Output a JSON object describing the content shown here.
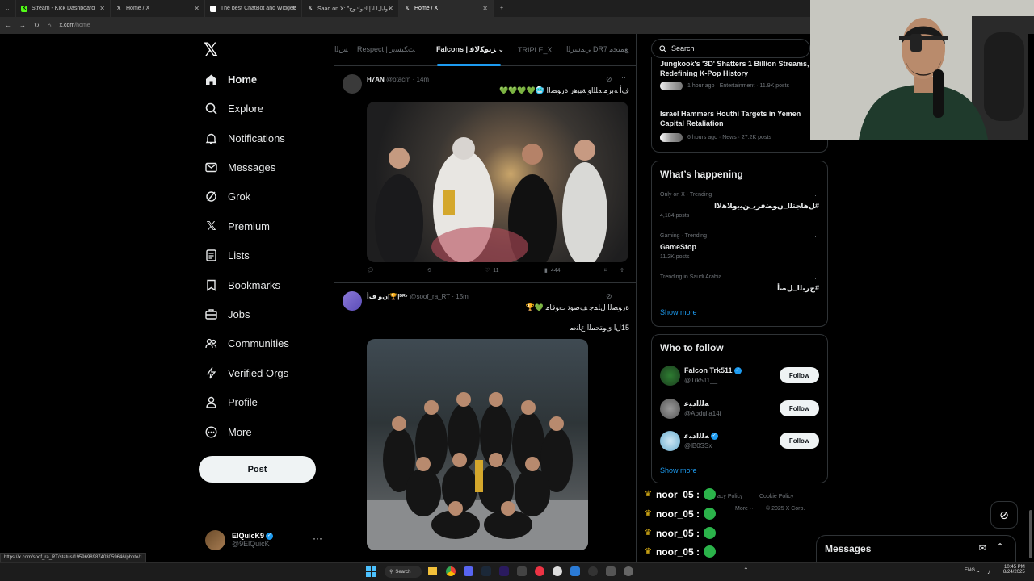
{
  "browser": {
    "tabs": [
      {
        "title": "Stream - Kick Dashboard",
        "icon": "kick-icon",
        "color": "#53fc18"
      },
      {
        "title": "Home / X",
        "icon": "x-icon",
        "color": "#ffffff"
      },
      {
        "title": "The best ChatBot and Widgets",
        "icon": "chatbot-icon",
        "color": "#ffffff"
      },
      {
        "title": "Saad on X: \"ﺫﻭﺍﺑﻝﺍ ﺍﺫﺇ ﻙﻭﻙﻭﺝ",
        "icon": "x-icon",
        "color": "#ffffff"
      },
      {
        "title": "Home / X",
        "icon": "x-icon",
        "color": "#ffffff",
        "active": true
      }
    ],
    "url_host": "x.com",
    "url_path": "/home",
    "status_url": "https://x.com/soof_ra_RT/status/1959698987403059646/photo/1"
  },
  "nav": {
    "items": [
      {
        "label": "Home",
        "icon": "home-icon"
      },
      {
        "label": "Explore",
        "icon": "search-icon"
      },
      {
        "label": "Notifications",
        "icon": "bell-icon"
      },
      {
        "label": "Messages",
        "icon": "mail-icon"
      },
      {
        "label": "Grok",
        "icon": "grok-icon"
      },
      {
        "label": "Premium",
        "icon": "x-icon"
      },
      {
        "label": "Lists",
        "icon": "list-icon"
      },
      {
        "label": "Bookmarks",
        "icon": "bookmark-icon"
      },
      {
        "label": "Jobs",
        "icon": "briefcase-icon"
      },
      {
        "label": "Communities",
        "icon": "people-icon"
      },
      {
        "label": "Verified Orgs",
        "icon": "lightning-icon"
      },
      {
        "label": "Profile",
        "icon": "person-icon"
      },
      {
        "label": "More",
        "icon": "more-circle-icon"
      }
    ],
    "post_label": "Post",
    "account_name": "ElQuicK9",
    "account_handle": "@9ElQuicK"
  },
  "timeline": {
    "tabs": [
      "ﺲﻟﺍ",
      "Respect | ﺖﻜﺒﺴﻳﺭ",
      "Falcons | ﺰﻧﻮﻜﻟﺎﻓ",
      "TRIPLE_X",
      "ﻲﻤﺳﺮﻟﺍ DR7 ﻊﻤﺘﺠﻣ"
    ],
    "active_tab": 2,
    "tweets": [
      {
        "name": "H7AN",
        "handle": "@otacrn",
        "time": "· 14m",
        "text": "ﻑﺃ ﻪﺑﺮﻣ ﻪﻠﻟﺍﻭ ﺔﺒﻴﻫﺭ ﺓﺭﻮﺼﻟﺍ 🥶💚💚💚💚",
        "replies": "",
        "retweets": "",
        "likes": "11",
        "views": "444"
      },
      {
        "name": "ﻥﻭ ﻑﺃ|🏆|ᴰᴿ⁷",
        "handle": "@soof_ra_RT",
        "time": "· 15m",
        "text": "ﺓﺭﻮﺼﻟﺍ ﻝﺎﻤﺟ ﻒﺻﻮﺗ ﺕﻮﻗﺎﻣ 💚🏆",
        "text2": "15ﻝﺍ ﻯﻮﺘﺤﻤﻟﺍ ﻉﺎﻨﺻ"
      }
    ]
  },
  "right": {
    "search_placeholder": "Search",
    "news": [
      {
        "title": "Jungkook's '3D' Shatters 1 Billion Streams, Redefining K-Pop History",
        "meta": "1 hour ago · Entertainment · 11.9K posts"
      },
      {
        "title": "Israel Hammers Houthi Targets in Yemen Capital Retaliation",
        "meta": "6 hours ago · News · 27.2K posts"
      }
    ],
    "happening_title": "What’s happening",
    "trends": [
      {
        "context": "Only on X · Trending",
        "title": "#ﻞﻫﺎﺠﺘﻟﺍ_ﻥﻮﻀﻓﺮﻳ_ﻦﻴﻳﻭﻼﻫﻻﺍ",
        "posts": "4,184 posts"
      },
      {
        "context": "Gaming · Trending",
        "title": "GameStop",
        "posts": "11.2K posts"
      },
      {
        "context": "Trending in Saudi Arabia",
        "title": "#ﺝﺮﺒﻟﺍ_ﻞﺻﺃ",
        "posts": ""
      }
    ],
    "show_more": "Show more",
    "who_title": "Who to follow",
    "follow": [
      {
        "name": "Falcon Trk511",
        "handle": "@Trk511__",
        "verified": true
      },
      {
        "name": "ﻪﻠﻟﺍﺪﺒﻋ",
        "handle": "@Abdulla14i",
        "verified": false
      },
      {
        "name": "ﻪﻠﻟﺍﺪﺒﻋ",
        "handle": "@lB0SSx",
        "verified": true
      }
    ],
    "follow_label": "Follow",
    "footer": [
      "acy Policy",
      "Cookie Policy",
      "More ···",
      "© 2025 X Corp."
    ]
  },
  "chat": {
    "lines": [
      "noor_05 :",
      "noor_05 :",
      "noor_05 :",
      "noor_05 :",
      "noor_05 :"
    ]
  },
  "messages_drawer": {
    "label": "Messages"
  },
  "taskbar": {
    "search_label": "Search",
    "lang": "ENG",
    "time": "10:45 PM",
    "date": "8/24/2025"
  }
}
